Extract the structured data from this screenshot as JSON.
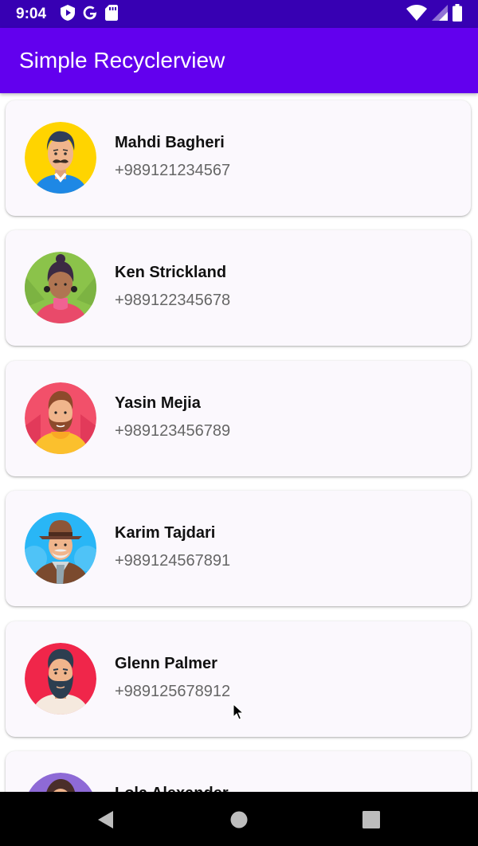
{
  "status_bar": {
    "time": "9:04",
    "left_icons": [
      "play-protect-icon",
      "google-icon",
      "sd-card-icon"
    ],
    "right_icons": [
      "wifi-icon",
      "cell-signal-icon",
      "battery-icon"
    ]
  },
  "app_bar": {
    "title": "Simple Recyclerview",
    "color": "#6200ee",
    "status_color": "#3700b3"
  },
  "contacts": [
    {
      "name": "Mahdi Bagheri",
      "phone": "+989121234567",
      "avatar": "man-mustache-avatar",
      "avatar_bg": "#ffd400"
    },
    {
      "name": "Ken Strickland",
      "phone": "+989122345678",
      "avatar": "woman-earrings-avatar",
      "avatar_bg": "#8bc34a"
    },
    {
      "name": "Yasin Mejia",
      "phone": "+989123456789",
      "avatar": "man-beard-hoodie-avatar",
      "avatar_bg": "#f2506a"
    },
    {
      "name": "Karim Tajdari",
      "phone": "+989124567891",
      "avatar": "man-hat-scarf-avatar",
      "avatar_bg": "#29b6f6"
    },
    {
      "name": "Glenn Palmer",
      "phone": "+989125678912",
      "avatar": "man-beard-avatar",
      "avatar_bg": "#f0264a"
    },
    {
      "name": "Lola Alexander",
      "phone": "",
      "avatar": "woman-avatar",
      "avatar_bg": "#8e6ad6"
    }
  ],
  "nav_bar": {
    "buttons": [
      "back-icon",
      "home-icon",
      "recents-icon"
    ]
  }
}
